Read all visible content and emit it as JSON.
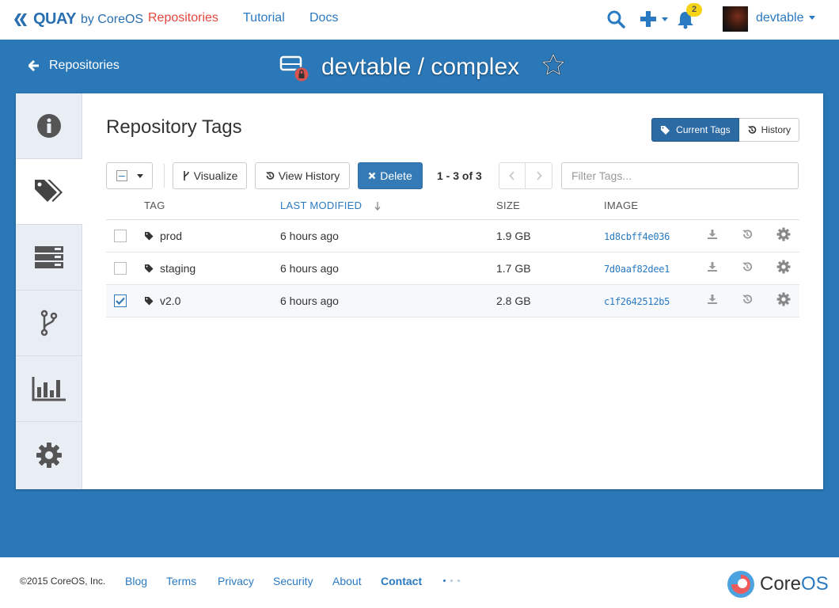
{
  "navbar": {
    "brand": "QUAY",
    "brand_by": "by CoreOS",
    "links": [
      "Repositories",
      "Tutorial",
      "Docs"
    ],
    "notification_count": "2",
    "username": "devtable"
  },
  "header": {
    "back_label": "Repositories",
    "repo_title": "devtable / complex"
  },
  "tabs": [
    "info-icon",
    "tags-icon",
    "builds-icon",
    "git-branch-icon",
    "chart-icon",
    "gear-icon"
  ],
  "tags_section": {
    "title": "Repository Tags",
    "toggle_current": "Current Tags",
    "toggle_history": "History",
    "visualize_label": "Visualize",
    "view_history_label": "View History",
    "delete_label": "Delete",
    "paging": "1 - 3 of 3",
    "filter_placeholder": "Filter Tags...",
    "columns": {
      "tag": "TAG",
      "last_modified": "LAST MODIFIED",
      "size": "SIZE",
      "image": "IMAGE"
    },
    "rows": [
      {
        "tag": "prod",
        "modified": "6 hours ago",
        "size": "1.9 GB",
        "image": "1d8cbff4e036",
        "selected": false
      },
      {
        "tag": "staging",
        "modified": "6 hours ago",
        "size": "1.7 GB",
        "image": "7d0aaf82dee1",
        "selected": false
      },
      {
        "tag": "v2.0",
        "modified": "6 hours ago",
        "size": "2.8 GB",
        "image": "c1f2642512b5",
        "selected": true
      }
    ]
  },
  "footer": {
    "copyright": "©2015 CoreOS, Inc.",
    "links": [
      "Blog",
      "Terms",
      "Privacy",
      "Security",
      "About",
      "Contact"
    ],
    "brand_core": "Core",
    "brand_os": "OS"
  },
  "colors": {
    "band": "#2a78b8",
    "active_nav": "#e2483d",
    "link": "#2a7ac2",
    "primary_button": "#337ab7"
  }
}
